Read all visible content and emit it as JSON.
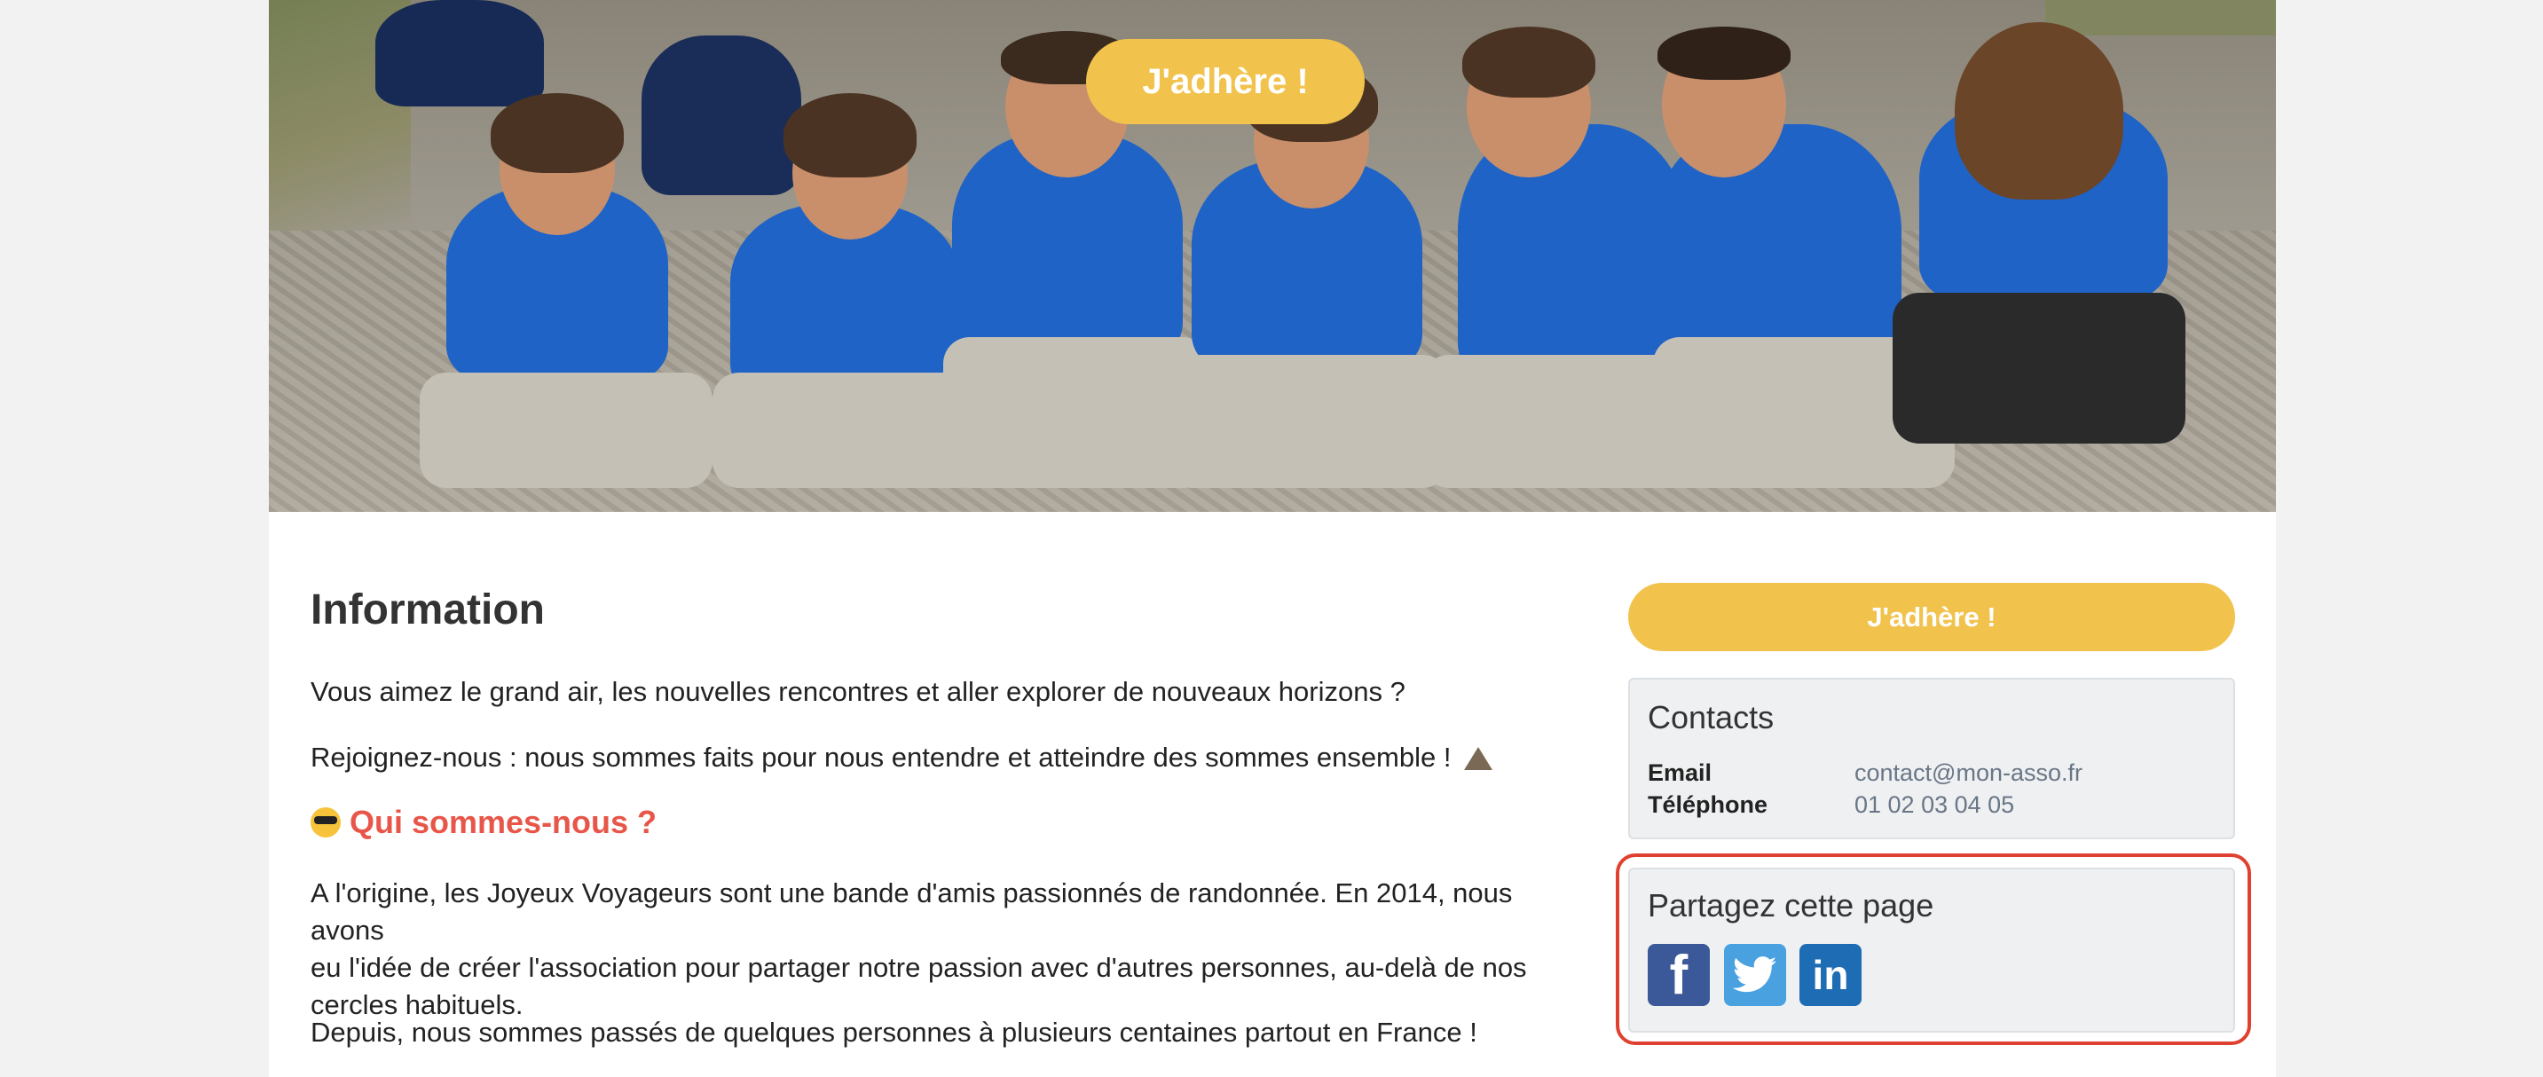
{
  "hero": {
    "cta_label": "J'adhère !"
  },
  "main": {
    "title": "Information",
    "paragraph1": "Vous aimez le grand air, les nouvelles rencontres et aller explorer de nouveaux horizons ?",
    "paragraph2": "Rejoignez-nous : nous sommes faits pour nous entendre et atteindre des sommes ensemble !",
    "subheading": "Qui sommes-nous ?",
    "paragraph3_line1": "A l'origine, les Joyeux Voyageurs sont une bande d'amis passionnés de randonnée. En 2014, nous avons",
    "paragraph3_line2": "eu l'idée de créer l'association pour partager notre passion avec d'autres personnes, au-delà de nos",
    "paragraph3_line3": "cercles habituels.",
    "paragraph4": "Depuis, nous sommes passés de quelques personnes à plusieurs centaines partout en France !"
  },
  "sidebar": {
    "cta_label": "J'adhère !",
    "contacts": {
      "title": "Contacts",
      "email_label": "Email",
      "email_value": "contact@mon-asso.fr",
      "phone_label": "Téléphone",
      "phone_value": "01 02 03 04 05"
    },
    "share": {
      "title": "Partagez cette page",
      "icons": [
        "facebook-icon",
        "twitter-icon",
        "linkedin-icon"
      ]
    }
  },
  "colors": {
    "cta": "#f1c34d",
    "subheading": "#e8564a",
    "highlight": "#e0402f",
    "facebook": "#3b5998",
    "twitter": "#4aa1e0",
    "linkedin": "#1e6cb3"
  }
}
